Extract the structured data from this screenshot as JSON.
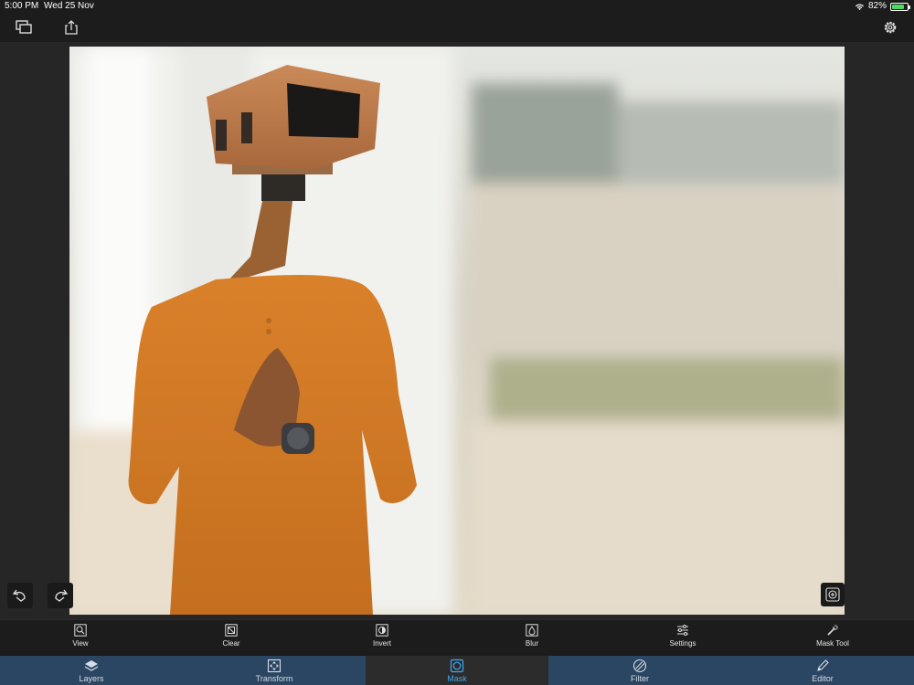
{
  "status_bar": {
    "time": "5:00 PM",
    "date": "Wed 25 Nov",
    "battery_percent": "82%",
    "battery_level": 0.82,
    "icons": [
      "wifi-icon",
      "battery-charging-icon"
    ]
  },
  "top_toolbar": {
    "icons": [
      "layers-stack-icon",
      "share-icon",
      "gear-icon"
    ]
  },
  "canvas": {
    "image_subject": "person in orange sweater with security camera head"
  },
  "history": {
    "icons": [
      "undo-icon",
      "redo-icon",
      "zoom-in-icon"
    ]
  },
  "mask_toolbar": {
    "tools": [
      {
        "label": "View",
        "icon": "view-zoom-icon"
      },
      {
        "label": "Clear",
        "icon": "clear-icon"
      },
      {
        "label": "Invert",
        "icon": "invert-icon"
      },
      {
        "label": "Blur",
        "icon": "blur-drop-icon"
      },
      {
        "label": "Settings",
        "icon": "sliders-icon"
      },
      {
        "label": "Mask Tool",
        "icon": "magic-wand-icon"
      }
    ]
  },
  "tab_bar": {
    "tabs": [
      {
        "label": "Layers",
        "icon": "layers-icon"
      },
      {
        "label": "Transform",
        "icon": "transform-icon"
      },
      {
        "label": "Mask",
        "icon": "mask-icon",
        "active": true
      },
      {
        "label": "Filter",
        "icon": "filter-icon"
      },
      {
        "label": "Editor",
        "icon": "pencil-icon"
      }
    ],
    "active_color": "#3fa9f5",
    "background_color": "#2b4663"
  }
}
